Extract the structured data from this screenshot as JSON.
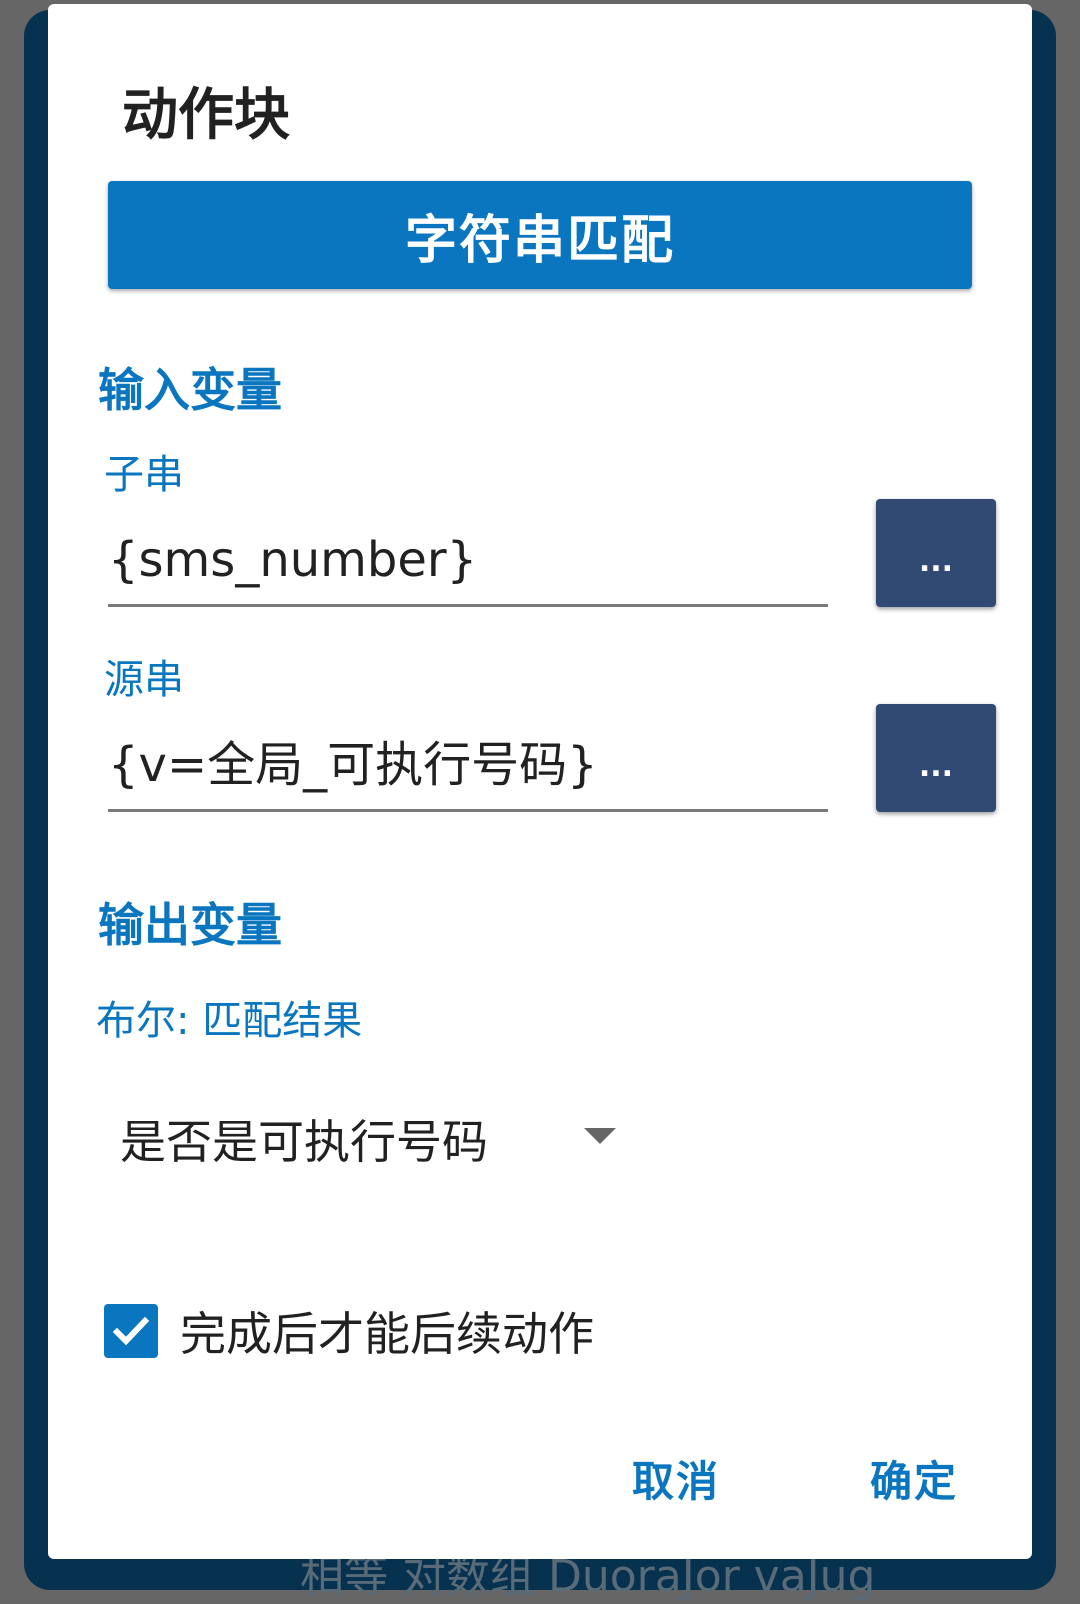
{
  "background": {
    "behind_text": "相等 对数组 DuoraJor vaJug"
  },
  "dialog": {
    "title": "动作块",
    "header_button_label": "字符串匹配",
    "input_section": {
      "heading": "输入变量",
      "fields": [
        {
          "label": "子串",
          "value": "{sms_number}",
          "picker_label": "..."
        },
        {
          "label": "源串",
          "value": "{v=全局_可执行号码}",
          "picker_label": "..."
        }
      ]
    },
    "output_section": {
      "heading": "输出变量",
      "variable_label": "布尔: 匹配结果",
      "selected_variable": "是否是可执行号码"
    },
    "checkbox": {
      "label": "完成后才能后续动作",
      "checked": true
    },
    "buttons": {
      "cancel": "取消",
      "ok": "确定"
    }
  },
  "colors": {
    "accent": "#0a76bf",
    "picker_button": "#304a74",
    "backdrop": "#06314f"
  }
}
